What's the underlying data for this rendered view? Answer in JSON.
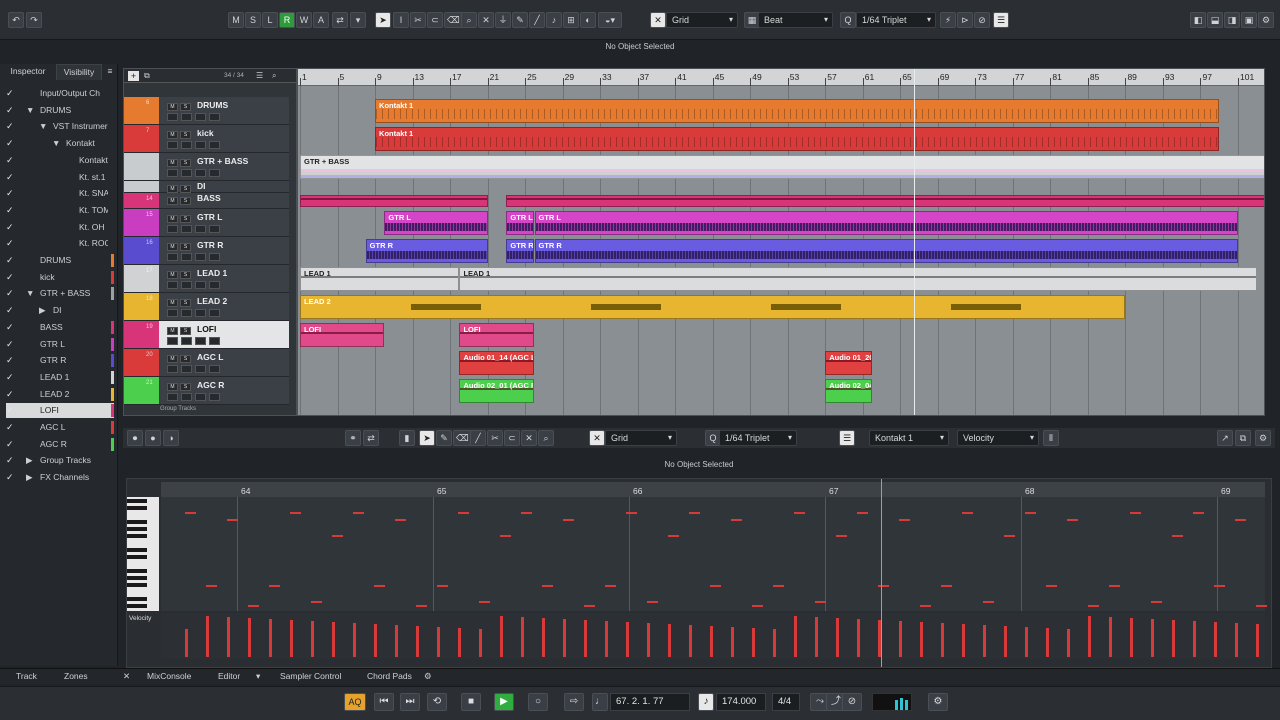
{
  "toolbar": {
    "state_buttons": [
      "M",
      "S",
      "L",
      "R",
      "W",
      "A"
    ],
    "grid_type": "Grid",
    "grid_mode": "Beat",
    "quantize": "1/64  Triplet"
  },
  "status_top": "No Object Selected",
  "left": {
    "tabs": [
      "Inspector",
      "Visibility"
    ],
    "items": [
      {
        "label": "Input/Output Ch",
        "indent": 0,
        "twist": "",
        "color": ""
      },
      {
        "label": "DRUMS",
        "indent": 0,
        "twist": "▼",
        "color": ""
      },
      {
        "label": "VST Instrumer",
        "indent": 1,
        "twist": "▼",
        "color": ""
      },
      {
        "label": "Kontakt",
        "indent": 2,
        "twist": "▼",
        "color": ""
      },
      {
        "label": "Kontakt",
        "indent": 3,
        "twist": "",
        "color": ""
      },
      {
        "label": "Kt. st.1",
        "indent": 3,
        "twist": "",
        "color": ""
      },
      {
        "label": "Kt. SNARE",
        "indent": 3,
        "twist": "",
        "color": ""
      },
      {
        "label": "Kt. TOM",
        "indent": 3,
        "twist": "",
        "color": ""
      },
      {
        "label": "Kt. OH",
        "indent": 3,
        "twist": "",
        "color": ""
      },
      {
        "label": "Kt. ROOM",
        "indent": 3,
        "twist": "",
        "color": ""
      },
      {
        "label": "DRUMS",
        "indent": 0,
        "twist": "",
        "color": "#e67a2e"
      },
      {
        "label": "kick",
        "indent": 0,
        "twist": "",
        "color": "#d93a3a"
      },
      {
        "label": "GTR + BASS",
        "indent": 0,
        "twist": "▼",
        "color": "#9aa0a6"
      },
      {
        "label": "DI",
        "indent": 1,
        "twist": "▶",
        "color": ""
      },
      {
        "label": "BASS",
        "indent": 0,
        "twist": "",
        "color": "#d8347a"
      },
      {
        "label": "GTR L",
        "indent": 0,
        "twist": "",
        "color": "#c93ec0"
      },
      {
        "label": "GTR R",
        "indent": 0,
        "twist": "",
        "color": "#5a4ccf"
      },
      {
        "label": "LEAD 1",
        "indent": 0,
        "twist": "",
        "color": "#d0d2d4"
      },
      {
        "label": "LEAD 2",
        "indent": 0,
        "twist": "",
        "color": "#e7b530"
      },
      {
        "label": "LOFI",
        "indent": 0,
        "twist": "",
        "color": "#d8347a"
      },
      {
        "label": "AGC L",
        "indent": 0,
        "twist": "",
        "color": "#d93a3a"
      },
      {
        "label": "AGC R",
        "indent": 0,
        "twist": "",
        "color": "#4ccf4c"
      },
      {
        "label": "Group Tracks",
        "indent": 0,
        "twist": "▶",
        "color": ""
      },
      {
        "label": "FX Channels",
        "indent": 0,
        "twist": "▶",
        "color": ""
      }
    ]
  },
  "tracklist": {
    "count": "34 / 34",
    "tracks": [
      {
        "num": "6",
        "name": "DRUMS",
        "color": "#e67a2e"
      },
      {
        "num": "7",
        "name": "kick",
        "color": "#d93a3a"
      },
      {
        "num": "",
        "name": "GTR + BASS",
        "color": "#c9ccce"
      },
      {
        "num": "",
        "name": "DI",
        "color": "#c9ccce"
      },
      {
        "num": "14",
        "name": "BASS",
        "color": "#d8347a"
      },
      {
        "num": "15",
        "name": "GTR L",
        "color": "#c93ec0"
      },
      {
        "num": "16",
        "name": "GTR R",
        "color": "#5a4ccf"
      },
      {
        "num": "17",
        "name": "LEAD 1",
        "color": "#d0d2d4"
      },
      {
        "num": "18",
        "name": "LEAD 2",
        "color": "#e7b530"
      },
      {
        "num": "19",
        "name": "LOFI",
        "color": "#d8347a"
      },
      {
        "num": "20",
        "name": "AGC L",
        "color": "#d93a3a"
      },
      {
        "num": "21",
        "name": "AGC R",
        "color": "#4ccf4c"
      }
    ],
    "bottom_label": "Group Tracks"
  },
  "ruler": {
    "bars": [
      "1",
      "5",
      "9",
      "13",
      "17",
      "21",
      "25",
      "29",
      "33",
      "37",
      "41",
      "45",
      "49",
      "53",
      "57",
      "61",
      "65",
      "69",
      "73",
      "77",
      "81",
      "85",
      "89",
      "93",
      "97",
      "101"
    ]
  },
  "parts": [
    {
      "label": "Kontakt 1",
      "track": 0,
      "start": 9,
      "end": 99,
      "color": "#e67a2e",
      "wave": "midi"
    },
    {
      "label": "Kontakt 1",
      "track": 1,
      "start": 9,
      "end": 99,
      "color": "#d93a3a",
      "wave": "midi"
    },
    {
      "label": "GTR + BASS",
      "track": 2,
      "start": 1,
      "end": 106,
      "color": "#e2e3e4",
      "wave": "folder"
    },
    {
      "label": "",
      "track": 4,
      "start": 1,
      "end": 21,
      "color": "#d8347a",
      "wave": "line"
    },
    {
      "label": "",
      "track": 4,
      "start": 23,
      "end": 106,
      "color": "#d8347a",
      "wave": "line"
    },
    {
      "label": "GTR L",
      "track": 5,
      "start": 10,
      "end": 21,
      "color": "#d545c8",
      "wave": "audio"
    },
    {
      "label": "GTR L",
      "track": 5,
      "start": 23,
      "end": 26,
      "color": "#d545c8",
      "wave": "audio"
    },
    {
      "label": "GTR L",
      "track": 5,
      "start": 26,
      "end": 101,
      "color": "#d545c8",
      "wave": "audio"
    },
    {
      "label": "GTR R",
      "track": 6,
      "start": 8,
      "end": 21,
      "color": "#6a5ce0",
      "wave": "audio"
    },
    {
      "label": "GTR R",
      "track": 6,
      "start": 23,
      "end": 26,
      "color": "#6a5ce0",
      "wave": "audio"
    },
    {
      "label": "GTR R",
      "track": 6,
      "start": 26,
      "end": 101,
      "color": "#6a5ce0",
      "wave": "audio"
    },
    {
      "label": "LEAD 1",
      "track": 7,
      "start": 1,
      "end": 18,
      "color": "#dadcde",
      "wave": "thin"
    },
    {
      "label": "LEAD 1",
      "track": 7,
      "start": 18,
      "end": 103,
      "color": "#dadcde",
      "wave": "thin"
    },
    {
      "label": "LEAD 2",
      "track": 8,
      "start": 1,
      "end": 89,
      "color": "#e7b530",
      "wave": "sparse"
    },
    {
      "label": "LOFI",
      "track": 9,
      "start": 1,
      "end": 10,
      "color": "#e04a8a",
      "wave": "line"
    },
    {
      "label": "LOFI",
      "track": 9,
      "start": 18,
      "end": 26,
      "color": "#e04a8a",
      "wave": "line"
    },
    {
      "label": "Audio 01_14 (AGC L",
      "track": 10,
      "start": 18,
      "end": 26,
      "color": "#e04040",
      "wave": "line"
    },
    {
      "label": "Audio 01_20",
      "track": 10,
      "start": 57,
      "end": 62,
      "color": "#e04040",
      "wave": "line"
    },
    {
      "label": "Audio 02_01 (AGC R",
      "track": 11,
      "start": 18,
      "end": 26,
      "color": "#4ccf4c",
      "wave": "line"
    },
    {
      "label": "Audio 02_04",
      "track": 11,
      "start": 57,
      "end": 62,
      "color": "#4ccf4c",
      "wave": "line"
    }
  ],
  "editor": {
    "grid_type": "Grid",
    "quantize": "1/64  Triplet",
    "instrument": "Kontakt 1",
    "controller": "Velocity",
    "status": "No Object Selected",
    "bars": [
      "64",
      "65",
      "66",
      "67",
      "68",
      "69"
    ],
    "velocity_label": "Velocity"
  },
  "bottom_tabs": [
    "Track",
    "Zones",
    "MixConsole",
    "Editor",
    "Sampler Control",
    "Chord Pads"
  ],
  "transport": {
    "aq_label": "AQ",
    "position": "67. 2. 1. 77",
    "tempo": "174.000",
    "signature": "4/4"
  }
}
